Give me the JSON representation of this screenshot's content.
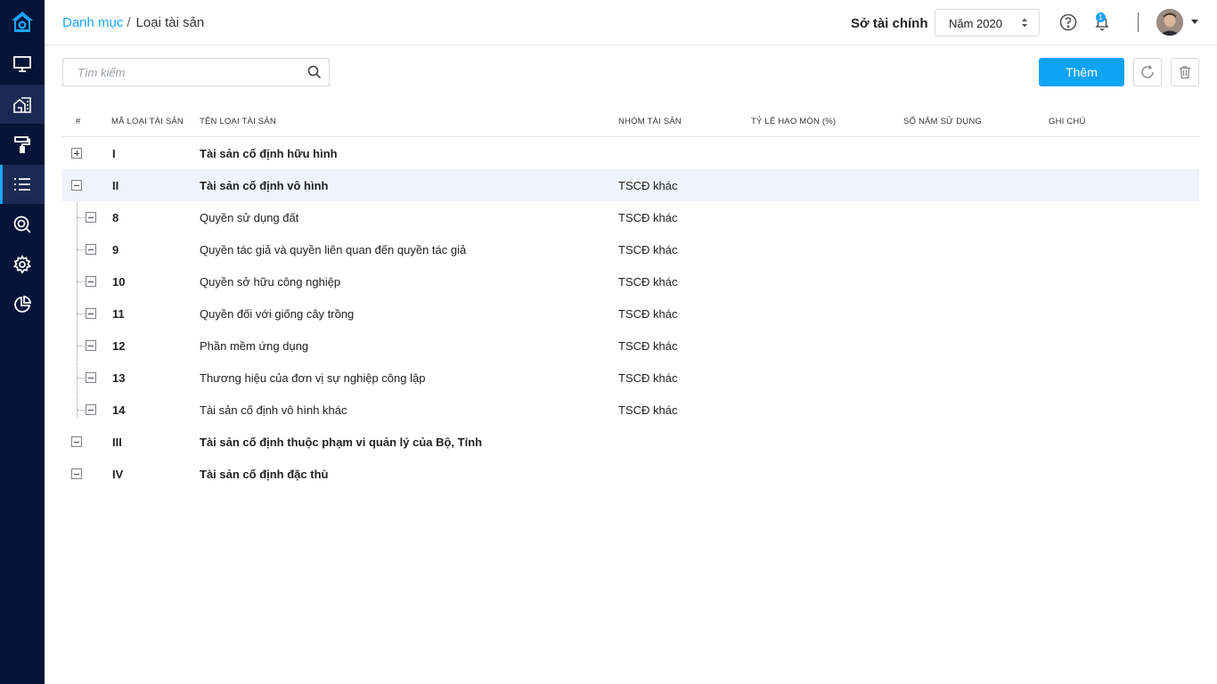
{
  "breadcrumb": {
    "parent": "Danh mục",
    "separator": "/",
    "current": "Loại tài sản"
  },
  "header": {
    "org_name": "Sở tài chính",
    "year_value": "Năm 2020",
    "notification_count": "1"
  },
  "sidebar": {
    "items": [
      {
        "icon": "monitor-icon"
      },
      {
        "icon": "building-icon"
      },
      {
        "icon": "paint-roller-icon"
      },
      {
        "icon": "list-icon"
      },
      {
        "icon": "search-report-icon"
      },
      {
        "icon": "gear-icon"
      },
      {
        "icon": "pie-chart-icon"
      }
    ]
  },
  "toolbar": {
    "search_placeholder": "Tìm kiếm",
    "add_label": "Thêm"
  },
  "table": {
    "columns": [
      "#",
      "Mã loại tài sản",
      "Tên loại tài sản",
      "Nhóm tài sản",
      "Tỷ lệ hao mòn (%)",
      "Số năm sử dụng",
      "Ghi chú"
    ],
    "rows": [
      {
        "code": "I",
        "name": "Tài sản cố định hữu hình",
        "group": "",
        "level": 0,
        "state": "collapsed"
      },
      {
        "code": "II",
        "name": "Tài sản cố định vô hình",
        "group": "TSCĐ khác",
        "level": 0,
        "state": "expanded"
      },
      {
        "code": "8",
        "name": "Quyền sử dụng đất",
        "group": "TSCĐ khác",
        "level": 1,
        "state": "expanded"
      },
      {
        "code": "9",
        "name": "Quyền tác giả và quyền liên quan đến quyền tác giả",
        "group": "TSCĐ khác",
        "level": 1,
        "state": "expanded"
      },
      {
        "code": "10",
        "name": "Quyền sở hữu công nghiệp",
        "group": "TSCĐ khác",
        "level": 1,
        "state": "expanded"
      },
      {
        "code": "11",
        "name": "Quyền đối với giống cây trồng",
        "group": "TSCĐ khác",
        "level": 1,
        "state": "expanded"
      },
      {
        "code": "12",
        "name": "Phần mềm ứng dụng",
        "group": "TSCĐ khác",
        "level": 1,
        "state": "expanded"
      },
      {
        "code": "13",
        "name": "Thương hiệu của đơn vị sự nghiệp công lập",
        "group": "TSCĐ khác",
        "level": 1,
        "state": "expanded"
      },
      {
        "code": "14",
        "name": "Tài sản cố định vô hình khác",
        "group": "TSCĐ khác",
        "level": 1,
        "state": "expanded"
      },
      {
        "code": "III",
        "name": "Tài sản cố định thuộc phạm vi quản lý của Bộ, Tỉnh",
        "group": "",
        "level": 0,
        "state": "expanded"
      },
      {
        "code": "IV",
        "name": "Tài sản cố định đặc thù",
        "group": "",
        "level": 0,
        "state": "expanded"
      }
    ]
  },
  "colors": {
    "accent": "#0fa3f4",
    "sidebar": "#061437",
    "row_highlight": "#eef4fb"
  }
}
